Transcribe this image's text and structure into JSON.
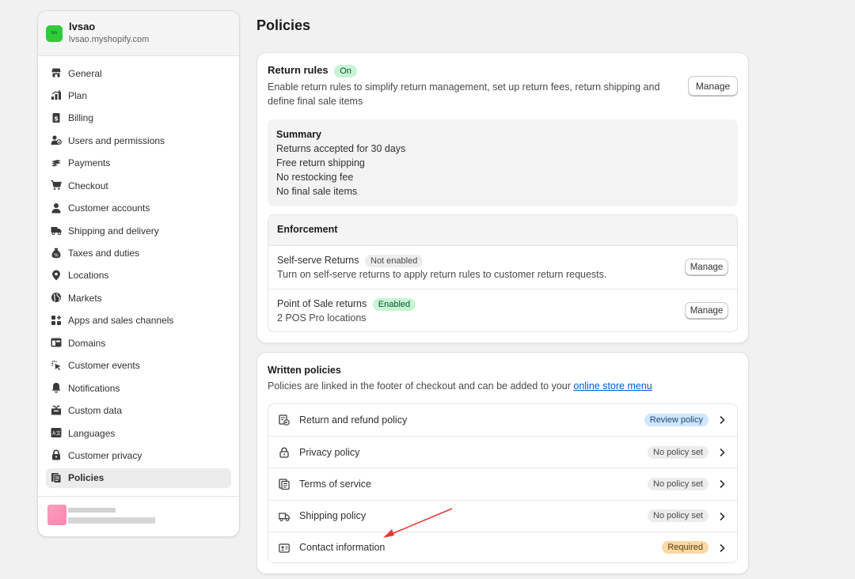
{
  "store": {
    "logo_text": "lvs",
    "name": "lvsao",
    "domain": "lvsao.myshopify.com"
  },
  "nav": [
    {
      "label": "General",
      "icon": "store-icon",
      "active": false
    },
    {
      "label": "Plan",
      "icon": "plan-icon",
      "active": false
    },
    {
      "label": "Billing",
      "icon": "billing-icon",
      "active": false
    },
    {
      "label": "Users and permissions",
      "icon": "users-icon",
      "active": false
    },
    {
      "label": "Payments",
      "icon": "payments-icon",
      "active": false
    },
    {
      "label": "Checkout",
      "icon": "cart-icon",
      "active": false
    },
    {
      "label": "Customer accounts",
      "icon": "person-icon",
      "active": false
    },
    {
      "label": "Shipping and delivery",
      "icon": "truck-icon",
      "active": false
    },
    {
      "label": "Taxes and duties",
      "icon": "tax-icon",
      "active": false
    },
    {
      "label": "Locations",
      "icon": "location-pin-icon",
      "active": false
    },
    {
      "label": "Markets",
      "icon": "globe-icon",
      "active": false
    },
    {
      "label": "Apps and sales channels",
      "icon": "apps-icon",
      "active": false
    },
    {
      "label": "Domains",
      "icon": "domain-icon",
      "active": false
    },
    {
      "label": "Customer events",
      "icon": "cursor-click-icon",
      "active": false
    },
    {
      "label": "Notifications",
      "icon": "bell-icon",
      "active": false
    },
    {
      "label": "Custom data",
      "icon": "custom-data-icon",
      "active": false
    },
    {
      "label": "Languages",
      "icon": "language-icon",
      "active": false
    },
    {
      "label": "Customer privacy",
      "icon": "lock-icon",
      "active": false
    },
    {
      "label": "Policies",
      "icon": "policy-icon",
      "active": true
    }
  ],
  "page": {
    "title": "Policies"
  },
  "return_rules": {
    "title": "Return rules",
    "status_badge": "On",
    "description": "Enable return rules to simplify return management, set up return fees, return shipping and define final sale items",
    "manage_label": "Manage",
    "summary": {
      "title": "Summary",
      "lines": [
        "Returns accepted for 30 days",
        "Free return shipping",
        "No restocking fee",
        "No final sale items"
      ]
    },
    "enforcement": {
      "title": "Enforcement",
      "rows": [
        {
          "title": "Self-serve Returns",
          "badge": "Not enabled",
          "subtitle": "Turn on self-serve returns to apply return rules to customer return requests.",
          "manage_label": "Manage"
        },
        {
          "title": "Point of Sale returns",
          "badge": "Enabled",
          "subtitle": "2 POS Pro locations",
          "manage_label": "Manage"
        }
      ]
    }
  },
  "written_policies": {
    "title": "Written policies",
    "description": "Policies are linked in the footer of checkout and can be added to your",
    "link_text": "online store menu",
    "items": [
      {
        "label": "Return and refund policy",
        "badge": "Review policy",
        "icon": "return-policy-icon"
      },
      {
        "label": "Privacy policy",
        "badge": "No policy set",
        "icon": "lock-icon"
      },
      {
        "label": "Terms of service",
        "badge": "No policy set",
        "icon": "terms-icon"
      },
      {
        "label": "Shipping policy",
        "badge": "No policy set",
        "icon": "truck-icon"
      },
      {
        "label": "Contact information",
        "badge": "Required",
        "icon": "contact-card-icon"
      }
    ]
  },
  "colors": {
    "accent_link": "#005bd3",
    "badge_on": "#c7f5d4",
    "badge_required": "#fad9a6",
    "badge_review": "#cfe6fb",
    "annotation_arrow": "#e53935"
  }
}
